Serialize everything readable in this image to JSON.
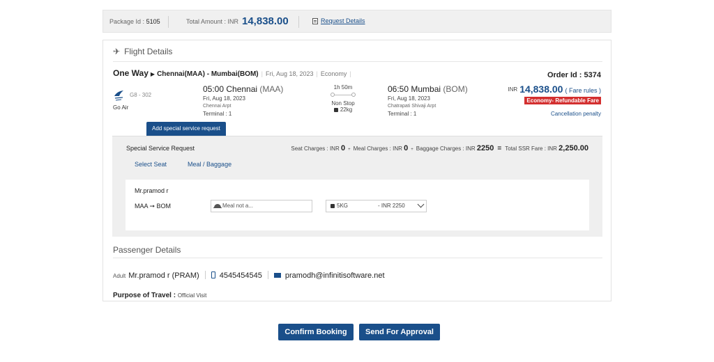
{
  "summary": {
    "package_label": "Package Id :",
    "package_id": "5105",
    "total_label": "Total Amount : INR",
    "total_value": "14,838.00",
    "request_details": "Request Details"
  },
  "flight": {
    "section_title": "Flight Details",
    "trip_type": "One Way",
    "route": "Chennai(MAA) - Mumbai(BOM)",
    "date": "Fri, Aug 18, 2023",
    "cabin": "Economy",
    "order_label": "Order Id : 5374",
    "flight_no": "G8 - 302",
    "airline": "Go Air",
    "departure": {
      "time_city": "05:00 Chennai",
      "code": "(MAA)",
      "date": "Fri, Aug 18, 2023",
      "airport": "Chennai Arpt",
      "terminal": "Terminal : 1"
    },
    "arrival": {
      "time_city": "06:50 Mumbai",
      "code": "(BOM)",
      "date": "Fri, Aug 18, 2023",
      "airport": "Chatrapati Shivaji Arpt",
      "terminal": "Terminal : 1"
    },
    "duration": "1h 50m",
    "stops": "Non Stop",
    "baggage": "22kg",
    "currency": "INR",
    "price": "14,838.00",
    "fare_rules": "( Fare rules )",
    "fare_type": "Economy- Refundable Fare",
    "cancellation": "Cancellation penalty"
  },
  "ssr": {
    "tab_label": "Add special service request",
    "heading": "Special Service Request",
    "seat_label": "Seat Charges : INR",
    "seat_value": "0",
    "meal_label": "Meal Charges : INR",
    "meal_value": "0",
    "baggage_label": "Baggage Charges : INR",
    "baggage_value": "2250",
    "total_label": "Total SSR Fare : INR",
    "total_value": "2,250.00",
    "tabs": [
      "Select Seat",
      "Meal / Baggage"
    ],
    "passenger": "Mr.pramod r",
    "leg": "MAA ➞ BOM",
    "meal_placeholder": "Meal not a...",
    "baggage_option": "5KG",
    "baggage_price": "- INR 2250"
  },
  "passenger": {
    "section_title": "Passenger Details",
    "type": "Adult",
    "name": "Mr.pramod r (PRAM)",
    "phone": "4545454545",
    "email": "pramodh@infinitisoftware.net",
    "purpose_label": "Purpose of Travel :",
    "purpose_value": "Official Visit"
  },
  "actions": {
    "confirm": "Confirm Booking",
    "approval": "Send For Approval"
  },
  "colors": {
    "primary": "#1a4f8a",
    "badge": "#d32f2f"
  }
}
